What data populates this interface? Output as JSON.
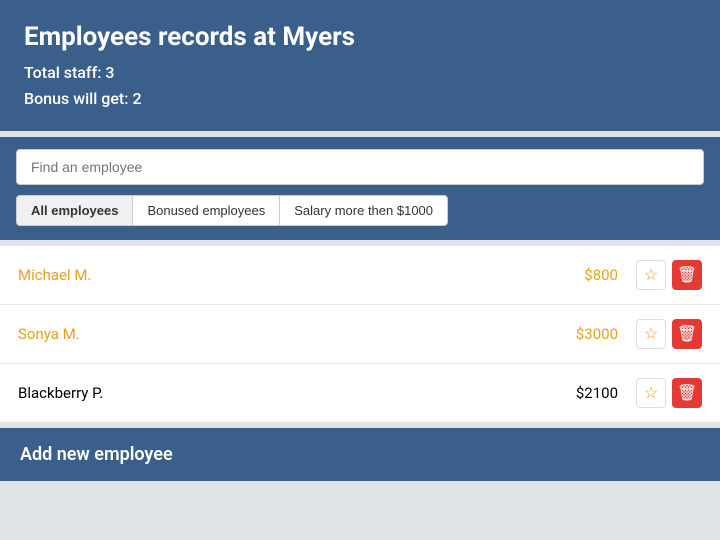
{
  "header": {
    "title": "Employees records at Myers",
    "total_staff_label": "Total staff: 3",
    "bonus_label": "Bonus will get: 2"
  },
  "search": {
    "placeholder": "Find an employee",
    "value": ""
  },
  "filters": [
    {
      "id": "all",
      "label": "All employees",
      "active": true
    },
    {
      "id": "bonused",
      "label": "Bonused employees",
      "active": false
    },
    {
      "id": "salary",
      "label": "Salary more then $1000",
      "active": false
    }
  ],
  "employees": [
    {
      "name": "Michael M.",
      "salary": "$800",
      "highlight": true
    },
    {
      "name": "Sonya M.",
      "salary": "$3000",
      "highlight": true
    },
    {
      "name": "Blackberry P.",
      "salary": "$2100",
      "highlight": false
    }
  ],
  "actions": {
    "edit_icon": "☆",
    "delete_icon": "🗑"
  },
  "add_section": {
    "title": "Add new employee"
  }
}
